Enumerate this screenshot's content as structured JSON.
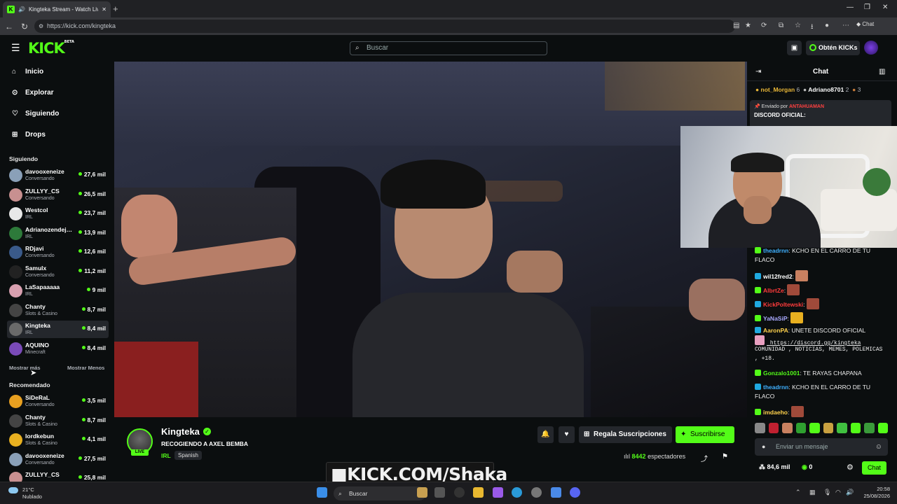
{
  "browser": {
    "tab_title": "Kingteka Stream - Watch Live",
    "url": "https://kick.com/kingteka",
    "chat_label": "Chat"
  },
  "header": {
    "logo": "KICK",
    "logo_sup": "BETA",
    "search_placeholder": "Buscar",
    "get_kicks": "Obtén KICKs"
  },
  "sidebar": {
    "nav": [
      {
        "label": "Inicio",
        "icon": "home-icon"
      },
      {
        "label": "Explorar",
        "icon": "compass-icon"
      },
      {
        "label": "Siguiendo",
        "icon": "heart-icon"
      },
      {
        "label": "Drops",
        "icon": "gift-icon"
      }
    ],
    "following_title": "Siguiendo",
    "following": [
      {
        "name": "davooxeneize",
        "category": "Conversando",
        "viewers": "27,6 mil",
        "color": "#8aa0b8"
      },
      {
        "name": "ZULLYY_CS",
        "category": "Conversando",
        "viewers": "26,5 mil",
        "color": "#c89090"
      },
      {
        "name": "Westcol",
        "category": "IRL",
        "viewers": "23,7 mil",
        "color": "#e8e8e8"
      },
      {
        "name": "Adrianozendej…",
        "category": "IRL",
        "viewers": "13,9 mil",
        "color": "#2d7a3a"
      },
      {
        "name": "RDjavi",
        "category": "Conversando",
        "viewers": "12,6 mil",
        "color": "#3a5a8a"
      },
      {
        "name": "Samulx",
        "category": "Conversando",
        "viewers": "11,2 mil",
        "color": "#222222"
      },
      {
        "name": "LaSapaaaaa",
        "category": "IRL",
        "viewers": "9 mil",
        "color": "#d8a0b0"
      },
      {
        "name": "Chanty",
        "category": "Slots & Casino",
        "viewers": "8,7 mil",
        "color": "#444444"
      },
      {
        "name": "Kingteka",
        "category": "IRL",
        "viewers": "8,4 mil",
        "color": "#6a6a6a"
      },
      {
        "name": "AQUINO",
        "category": "Minecraft",
        "viewers": "8,4 mil",
        "color": "#7a4ab8"
      }
    ],
    "show_more": "Mostrar más",
    "show_less": "Mostrar Menos",
    "recommended_title": "Recomendado",
    "recommended": [
      {
        "name": "SiDeRaL",
        "category": "Conversando",
        "viewers": "3,5 mil",
        "color": "#e8a020"
      },
      {
        "name": "Chanty",
        "category": "Slots & Casino",
        "viewers": "8,7 mil",
        "color": "#444444"
      },
      {
        "name": "lordkebun",
        "category": "Slots & Casino",
        "viewers": "4,1 mil",
        "color": "#e8b020"
      },
      {
        "name": "davooxeneize",
        "category": "Conversando",
        "viewers": "27,5 mil",
        "color": "#8aa0b8"
      },
      {
        "name": "ZULLYY_CS",
        "category": "",
        "viewers": "25,8 mil",
        "color": "#c89090"
      }
    ]
  },
  "stream": {
    "name": "Kingteka",
    "title": "RECOGIENDO A AXEL BEMBA",
    "category": "IRL",
    "language": "Spanish",
    "live": "LIVE",
    "gift_subs": "Regala Suscripciones",
    "subscribe": "Suscribirse",
    "viewers": "8442",
    "viewers_label": "espectadores",
    "watermark": "KICK.COM/Shaka"
  },
  "chat": {
    "title": "Chat",
    "top": [
      {
        "name": "not_Morgan",
        "count": "6"
      },
      {
        "name": "Adriano8701",
        "count": "2"
      },
      {
        "name": "",
        "count": "3"
      }
    ],
    "pinned_by_label": "Enviado por",
    "pinned_by": "ANTAHUAMAN",
    "pinned_text": "DISCORD OFICIAL:",
    "messages": [
      {
        "user": "theadrnn",
        "color": "#3fb0ff",
        "text": "KCHO EN EL CARRO DE TU FLACO"
      },
      {
        "user": "wil12fred2",
        "color": "#ffffff",
        "text": ""
      },
      {
        "user": "AlbrtZe",
        "color": "#ff3b3b",
        "text": ""
      },
      {
        "user": "KickPoltewski",
        "color": "#ff3b3b",
        "text": ""
      },
      {
        "user": "YaNaSiP",
        "color": "#a9a9ff",
        "text": ""
      },
      {
        "user": "AaronPA",
        "color": "#ffd24d",
        "text": "UNETE DISCORD OFICIAL"
      },
      {
        "user": "",
        "color": "#ffffff",
        "text": "https://discord.gg/kingteka"
      },
      {
        "user": "",
        "color": "#ffffff",
        "text": "COMUNIDAD , NOTICIAS, MEMES, POLEMICAS , +18."
      },
      {
        "user": "Gonzalo1001",
        "color": "#53fc18",
        "text": "TE RAYAS CHAPANA"
      },
      {
        "user": "theadrnn",
        "color": "#3fb0ff",
        "text": "KCHO EN EL CARRO DE TU FLACO"
      },
      {
        "user": "imdaeho",
        "color": "#ffd24d",
        "text": ""
      }
    ],
    "input_placeholder": "Enviar un mensaje",
    "kicks": "84,6 mil",
    "points": "0",
    "send": "Chat"
  },
  "taskbar": {
    "temp": "21°C",
    "weather": "Nublado",
    "search": "Buscar",
    "time": "20:58",
    "date": "25/08/2026"
  }
}
